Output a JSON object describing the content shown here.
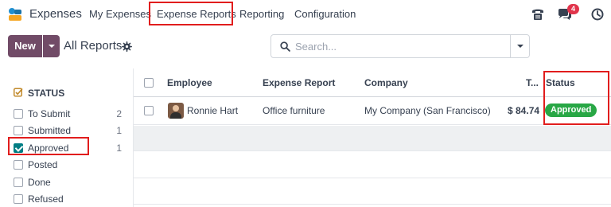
{
  "app": {
    "name": "Expenses"
  },
  "nav": {
    "my_expenses": "My Expenses",
    "expense_reports": "Expense Reports",
    "reporting": "Reporting",
    "configuration": "Configuration",
    "messages_badge": "4",
    "icons": [
      "phone-icon",
      "chat-icon",
      "clock-icon"
    ]
  },
  "control_panel": {
    "new_label": "New",
    "title": "All Reports",
    "search_placeholder": "Search..."
  },
  "sidebar": {
    "header": "STATUS",
    "filters": [
      {
        "label": "To Submit",
        "count": "2",
        "checked": false
      },
      {
        "label": "Submitted",
        "count": "1",
        "checked": false
      },
      {
        "label": "Approved",
        "count": "1",
        "checked": true
      },
      {
        "label": "Posted",
        "count": "",
        "checked": false
      },
      {
        "label": "Done",
        "count": "",
        "checked": false
      },
      {
        "label": "Refused",
        "count": "",
        "checked": false
      }
    ]
  },
  "list": {
    "columns": [
      "Employee",
      "Expense Report",
      "Company",
      "T...",
      "Status"
    ],
    "rows": [
      {
        "employee": "Ronnie Hart",
        "report": "Office furniture",
        "company": "My Company (San Francisco)",
        "total": "$ 84.74",
        "status": "Approved"
      }
    ]
  },
  "colors": {
    "brand": "#714b67",
    "approved": "#28a745",
    "badge": "#e1344b",
    "highlight": "#e11d1d",
    "check": "#017e84"
  }
}
